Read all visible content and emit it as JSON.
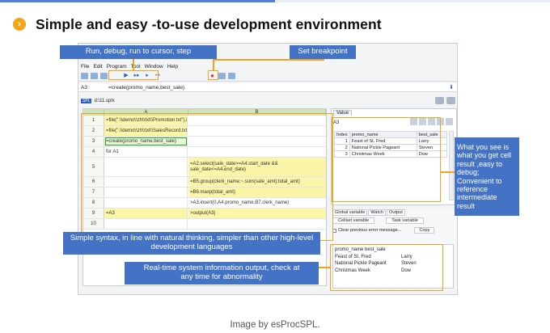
{
  "header": {
    "bullet_icon": "chevron-right-icon",
    "bullet_symbol": "›",
    "title": "Simple and easy -to-use development environment"
  },
  "app": {
    "menu": [
      "File",
      "Edit",
      "Program",
      "Tool",
      "Window",
      "Help"
    ],
    "cell_ref": "A3",
    "formula": "=create(promo_name,best_sale)",
    "file_name": "d:\\11.splx",
    "columns": [
      "A",
      "B"
    ],
    "rows": [
      {
        "num": "1",
        "a": "=file(\".\\\\demo\\\\zh\\\\txt\\\\Promotion.txt\").import@t()",
        "b": ""
      },
      {
        "num": "2",
        "a": "=file(\".\\\\demo\\\\zh\\\\txt\\\\SalesRecord.txt\").import@t()",
        "b": ""
      },
      {
        "num": "3",
        "a": "=create(promo_name,best_sale)",
        "b": ""
      },
      {
        "num": "4",
        "a": "for A1",
        "b": ""
      },
      {
        "num": "5",
        "a": "",
        "b": "=A2.select(sale_date>=A4.start_date && sale_date<=A4.end_date)"
      },
      {
        "num": "6",
        "a": "",
        "b": "=B5.group(clerk_name;~.sum(sale_amt):total_amt)"
      },
      {
        "num": "7",
        "a": "",
        "b": "=B6.maxp(total_amt)"
      },
      {
        "num": "8",
        "a": "",
        "b": ">A3.insert(0,A4.promo_name,B7.clerk_name)"
      },
      {
        "num": "9",
        "a": "=A3",
        "b": ">output(A3)"
      },
      {
        "num": "10",
        "a": "",
        "b": ""
      }
    ],
    "value_tab": "Value",
    "value_ref": "A3",
    "value_columns": [
      "Index",
      "promo_name",
      "best_sale"
    ],
    "value_rows": [
      [
        "1",
        "Feast of St. Fred",
        "Larry"
      ],
      [
        "2",
        "National Pickle Pageant",
        "Steven"
      ],
      [
        "3",
        "Christmas Week",
        "Dow"
      ]
    ],
    "lower_tabs": [
      "Global variable",
      "Watch",
      "Output"
    ],
    "lower_buttons": [
      "Cellset variable",
      "Task variable"
    ],
    "clear_label": "Clear previous error message...",
    "copy_label": "Copy",
    "output_header": "promo_name best_sale",
    "output_rows": [
      [
        "Feast of St. Fred",
        "Larry"
      ],
      [
        "National Pickle Pageant",
        "Steven"
      ],
      [
        "Christmas Week",
        "Dow"
      ]
    ]
  },
  "callouts": {
    "run": "Run, debug, run to cursor, step",
    "breakpoint": "Set breakpoint",
    "see": "What you see is what you get cell result ,easy to debug; Convenient to reference intermediate result",
    "syntax_1": "Simple syntax, in line with natural thinking, simpler than other high-level",
    "syntax_2": "development languages",
    "realtime_1": "Real-time system information output, check at",
    "realtime_2": "any time for abnormality"
  },
  "caption": "Image by esProcSPL.",
  "colors": {
    "accent_blue": "#4472c4",
    "highlight_orange": "#f0a31c",
    "bullet": "#f2a51a"
  }
}
